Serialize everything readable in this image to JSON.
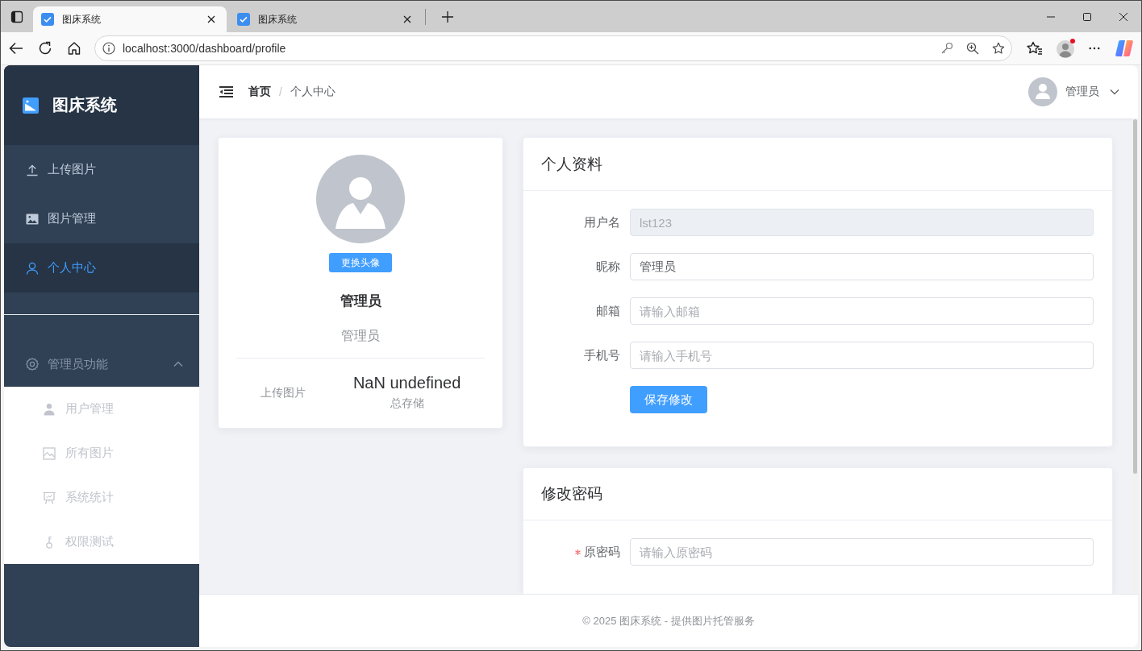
{
  "browser": {
    "tabs": [
      {
        "title": "图床系统",
        "selected": true
      },
      {
        "title": "图床系统",
        "selected": false
      }
    ],
    "address": "localhost:3000/dashboard/profile"
  },
  "sidebar": {
    "title": "图床系统",
    "items": [
      {
        "label": "上传图片",
        "selected": false
      },
      {
        "label": "图片管理",
        "selected": false
      },
      {
        "label": "个人中心",
        "selected": true
      }
    ],
    "group": {
      "label": "管理员功能",
      "expanded": true,
      "items": [
        {
          "label": "用户管理",
          "selected": false
        },
        {
          "label": "所有图片",
          "selected": false
        },
        {
          "label": "系统统计",
          "selected": false
        },
        {
          "label": "权限测试",
          "selected": false
        }
      ]
    }
  },
  "header": {
    "breadcrumb": {
      "separator": "/",
      "items": [
        {
          "label": "首页",
          "current": false
        },
        {
          "label": "个人中心",
          "current": true
        }
      ]
    },
    "user": "管理员"
  },
  "profile_card": {
    "avatar_button": "更换头像",
    "name": "管理员",
    "role": "管理员",
    "stats": [
      {
        "label": "上传图片"
      },
      {
        "value": "NaN undefined",
        "label": "总存储"
      }
    ]
  },
  "profile_form": {
    "title": "个人资料",
    "fields": [
      {
        "label": "用户名",
        "value": "lst123",
        "disabled": true,
        "required": false
      },
      {
        "label": "昵称",
        "value": "管理员",
        "disabled": false,
        "required": false
      },
      {
        "label": "邮箱",
        "placeholder": "请输入邮箱",
        "disabled": false,
        "required": false
      },
      {
        "label": "手机号",
        "placeholder": "请输入手机号",
        "disabled": false,
        "required": false
      }
    ],
    "submit": "保存修改"
  },
  "password_form": {
    "title": "修改密码",
    "fields": [
      {
        "label": "原密码",
        "placeholder": "请输入原密码",
        "disabled": false,
        "required": true
      }
    ]
  },
  "footer": "© 2025 图床系统 - 提供图片托管服务"
}
